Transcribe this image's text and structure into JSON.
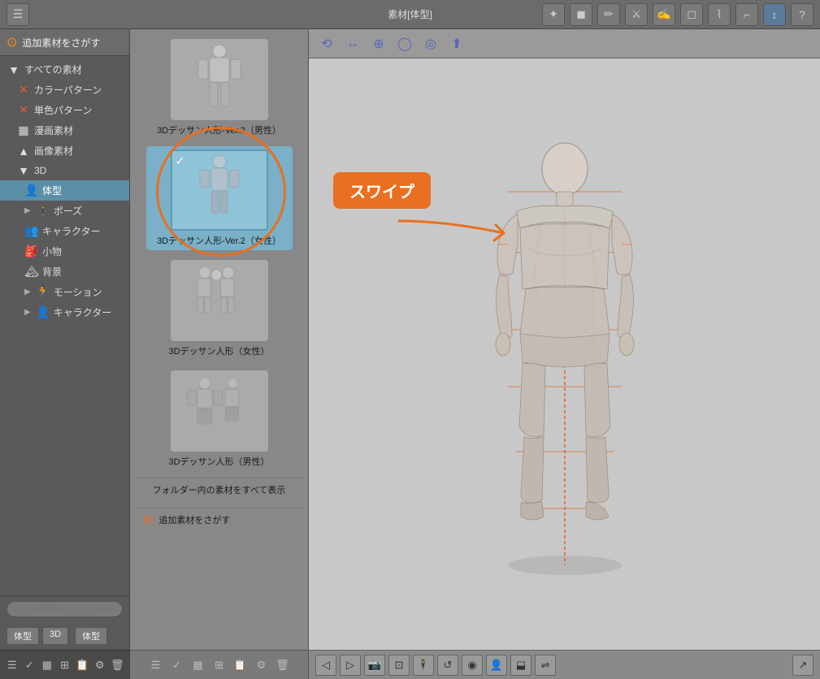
{
  "app": {
    "title": "素材[体型]",
    "add_material_label": "追加素材をさがす"
  },
  "toolbar": {
    "icons": [
      "✦",
      "◼",
      "✏",
      "⚔",
      "✍",
      "◻",
      "⌇",
      "⌐",
      "↕",
      "?"
    ]
  },
  "sidebar": {
    "items": [
      {
        "label": "すべての素材",
        "icon": "▼",
        "level": 0
      },
      {
        "label": "カラーパターン",
        "icon": "✕",
        "level": 1
      },
      {
        "label": "単色パターン",
        "icon": "✕",
        "level": 1
      },
      {
        "label": "漫画素材",
        "icon": "▦",
        "level": 1
      },
      {
        "label": "画像素材",
        "icon": "▲",
        "level": 1
      },
      {
        "label": "3D",
        "icon": "▼",
        "level": 1
      },
      {
        "label": "体型",
        "icon": "👤",
        "level": 2,
        "active": true
      },
      {
        "label": "ポーズ",
        "icon": "▶",
        "level": 2
      },
      {
        "label": "キャラクター",
        "icon": "👥",
        "level": 2
      },
      {
        "label": "小物",
        "icon": "🎒",
        "level": 2
      },
      {
        "label": "背景",
        "icon": "🏔",
        "level": 2
      },
      {
        "label": "モーション",
        "icon": "▶",
        "level": 2
      },
      {
        "label": "キャラクター",
        "icon": "👤",
        "level": 2
      }
    ],
    "search_placeholder": "ここに検索キーワードを",
    "tags": [
      "体型",
      "3D",
      "体型"
    ]
  },
  "materials": [
    {
      "id": 1,
      "label": "3Dデッサン人形-Ver.2（男性）",
      "type": "male",
      "selected": false
    },
    {
      "id": 2,
      "label": "3Dデッサン人形-Ver.2（女性）",
      "type": "female",
      "selected": true
    },
    {
      "id": 3,
      "label": "3Dデッサン人形（女性）",
      "type": "female_group",
      "selected": false
    },
    {
      "id": 4,
      "label": "3Dデッサン人形（男性）",
      "type": "male_group",
      "selected": false
    }
  ],
  "annotations": {
    "swipe_label": "スワイプ"
  },
  "canvas_toolbar": {
    "icons": [
      "⟲",
      "↔",
      "⊕",
      "◯",
      "◎",
      "⬆"
    ]
  },
  "folder_show_all": "フォルダー内の素材をすべて表示",
  "add_material": "追加素材をさがす"
}
